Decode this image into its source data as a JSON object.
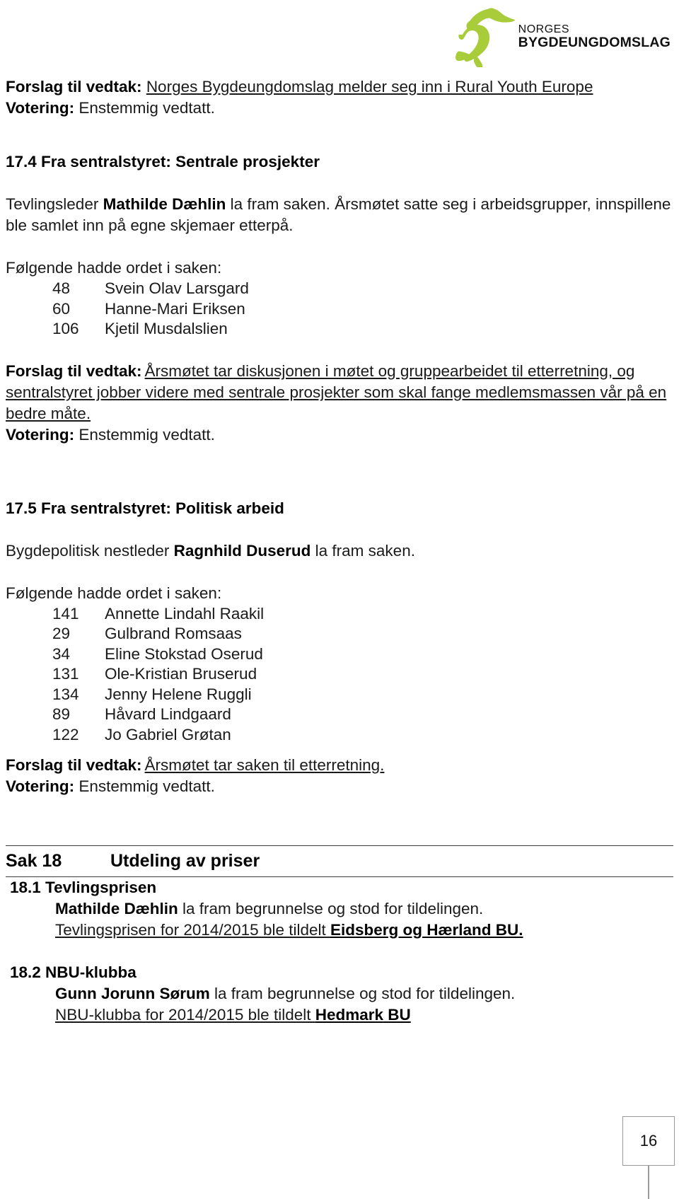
{
  "logo": {
    "line1": "NORGES",
    "line2": "BYGDEUNGDOMSLAG",
    "color": "#a9cc3a"
  },
  "blocks": {
    "top_decision": {
      "label": "Forslag til vedtak:",
      "text": "Norges Bygdeungdomslag melder seg inn i Rural Youth Europe"
    },
    "top_voting": {
      "label": "Votering:",
      "text": "Enstemmig vedtatt."
    },
    "section_17_4": {
      "heading": "17.4 Fra sentralstyret: Sentrale prosjekter",
      "intro_pre": "Tevlingsleder ",
      "intro_bold": "Mathilde Dæhlin",
      "intro_post": " la fram saken. Årsmøtet satte seg i arbeidsgrupper, innspillene ble samlet inn på egne skjemaer etterpå.",
      "speakers_label": "Følgende hadde ordet i saken:",
      "speakers": [
        {
          "num": "48",
          "name": "Svein Olav Larsgard"
        },
        {
          "num": "60",
          "name": "Hanne-Mari Eriksen"
        },
        {
          "num": "106",
          "name": "Kjetil Musdalslien"
        }
      ],
      "decision_label": "Forslag til vedtak:",
      "decision_text": "Årsmøtet tar diskusjonen i møtet og gruppearbeidet til etterretning, og sentralstyret jobber videre med sentrale prosjekter som skal fange medlemsmassen vår på en bedre måte.",
      "voting_label": "Votering:",
      "voting_text": "Enstemmig vedtatt."
    },
    "section_17_5": {
      "heading": "17.5 Fra sentralstyret: Politisk arbeid",
      "intro_pre": "Bygdepolitisk nestleder ",
      "intro_bold": "Ragnhild Duserud",
      "intro_post": " la fram saken.",
      "speakers_label": "Følgende hadde ordet i saken:",
      "speakers": [
        {
          "num": "141",
          "name": "Annette Lindahl Raakil"
        },
        {
          "num": "29",
          "name": "Gulbrand Romsaas"
        },
        {
          "num": "34",
          "name": "Eline Stokstad Oserud"
        },
        {
          "num": "131",
          "name": "Ole-Kristian Bruserud"
        },
        {
          "num": "134",
          "name": "Jenny Helene Ruggli"
        },
        {
          "num": "89",
          "name": "Håvard Lindgaard"
        },
        {
          "num": "122",
          "name": "Jo Gabriel Grøtan"
        }
      ],
      "decision_label": "Forslag til vedtak:",
      "decision_text": "Årsmøtet tar saken til etterretning.",
      "voting_label": "Votering:",
      "voting_text": "Enstemmig vedtatt."
    },
    "sak_18": {
      "number": "Sak 18",
      "title": "Utdeling av priser",
      "item_18_1": {
        "heading": "18.1 Tevlingsprisen",
        "line1_bold": "Mathilde Dæhlin",
        "line1_rest": " la fram begrunnelse og stod for tildelingen.",
        "line2_pre": "Tevlingsprisen for 2014/2015 ble tildelt ",
        "line2_bold": "Eidsberg og Hærland BU."
      },
      "item_18_2": {
        "heading": "18.2 NBU-klubba",
        "line1_bold": "Gunn Jorunn Sørum",
        "line1_rest": " la fram begrunnelse og stod for tildelingen.",
        "line2_pre": "NBU-klubba for 2014/2015 ble tildelt ",
        "line2_bold": "Hedmark BU"
      }
    }
  },
  "footer": {
    "page_number": "16"
  }
}
